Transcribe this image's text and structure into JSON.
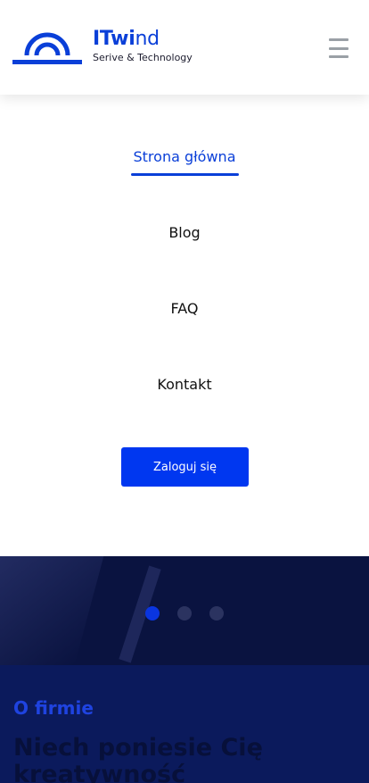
{
  "header": {
    "logo": {
      "word_bold": "ITwi",
      "word_light": "nd",
      "subtitle": "Serive & Technology",
      "color": "#0a3fd8"
    },
    "menu_icon": "hamburger-icon"
  },
  "nav": {
    "items": [
      {
        "label": "Strona główna",
        "active": true
      },
      {
        "label": "Blog",
        "active": false
      },
      {
        "label": "FAQ",
        "active": false
      },
      {
        "label": "Kontakt",
        "active": false
      }
    ],
    "login_label": "Zaloguj się",
    "accent": "#0037f0"
  },
  "carousel": {
    "slides": 3,
    "active_index": 0
  },
  "about": {
    "label": "O firmie",
    "title": "Niech poniesie Cię kreatywność"
  }
}
